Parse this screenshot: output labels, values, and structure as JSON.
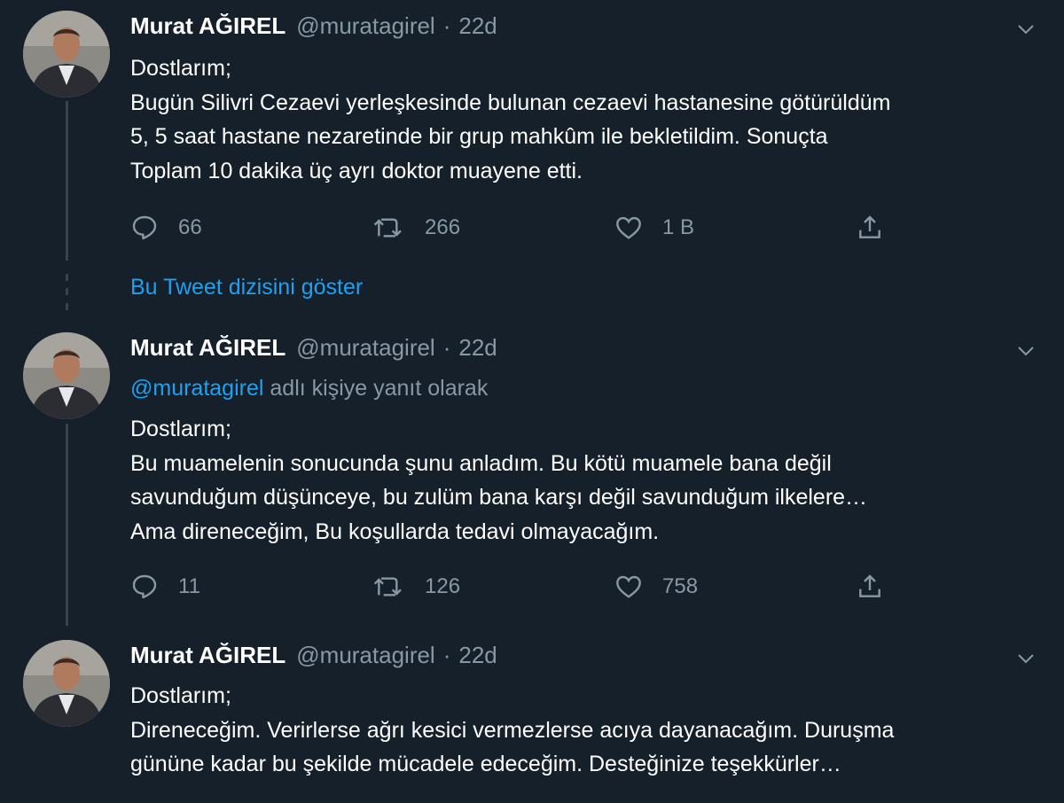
{
  "tweets": [
    {
      "author": {
        "name": "Murat AĞIREL",
        "handle": "@muratagirel"
      },
      "time": "22d",
      "lines": [
        "Dostlarım;",
        "Bugün Silivri Cezaevi yerleşkesinde bulunan cezaevi hastanesine götürüldüm",
        "5, 5 saat hastane nezaretinde bir grup mahkûm ile bekletildim. Sonuçta",
        "Toplam 10 dakika üç ayrı doktor muayene etti."
      ],
      "replies": "66",
      "retweets": "266",
      "likes": "1 B"
    },
    {
      "author": {
        "name": "Murat AĞIREL",
        "handle": "@muratagirel"
      },
      "time": "22d",
      "reply_to": {
        "mention": "@muratagirel",
        "suffix": " adlı kişiye yanıt olarak"
      },
      "lines": [
        "Dostlarım;",
        "Bu muamelenin sonucunda şunu anladım. Bu kötü muamele bana değil",
        "savunduğum düşünceye, bu zulüm bana karşı değil savunduğum ilkelere…",
        "Ama direneceğim, Bu koşullarda tedavi olmayacağım."
      ],
      "replies": "11",
      "retweets": "126",
      "likes": "758"
    },
    {
      "author": {
        "name": "Murat AĞIREL",
        "handle": "@muratagirel"
      },
      "time": "22d",
      "lines": [
        "Dostlarım;",
        "Direneceğim. Verirlerse ağrı kesici vermezlerse acıya dayanacağım.  Duruşma",
        "gününe kadar bu şekilde mücadele edeceğim.  Desteğinize teşekkürler…"
      ]
    }
  ],
  "show_thread_label": "Bu Tweet dizisini göster",
  "icons": {
    "reply": "reply-bubble-icon",
    "retweet": "retweet-icon",
    "like": "heart-icon",
    "share": "share-icon",
    "caret": "chevron-down-icon"
  },
  "colors": {
    "background": "#15202b",
    "secondary_text": "#8899a6",
    "link": "#1da1f2",
    "thread_line": "#38444d"
  }
}
